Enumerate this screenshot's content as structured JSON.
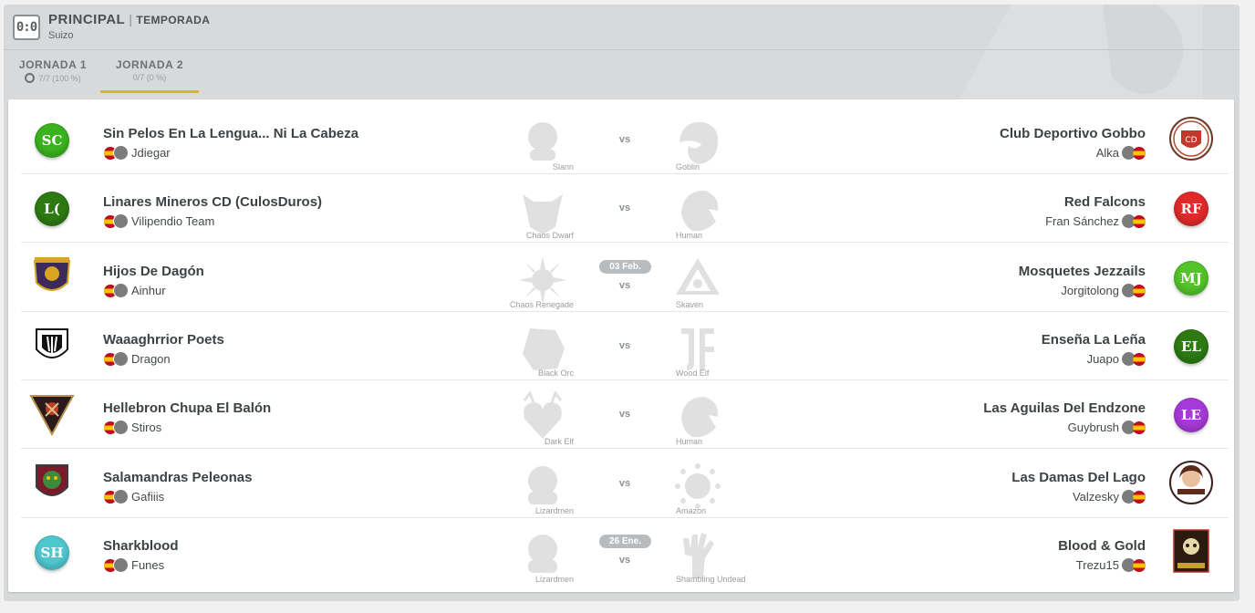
{
  "header": {
    "icon": "scoreboard-icon",
    "icon_text": "0:0",
    "title": "PRINCIPAL",
    "separator": "|",
    "subtitle": "TEMPORADA",
    "system": "Suizo"
  },
  "tabs": [
    {
      "label": "JORNADA 1",
      "stat": "7/7 (100 %)",
      "active": false
    },
    {
      "label": "JORNADA 2",
      "stat": "0/7 (0 %)",
      "active": true
    }
  ],
  "vs_label": "vs",
  "matches": [
    {
      "home": {
        "name": "Sin Pelos En La Lengua... Ni La Cabeza",
        "coach": "Jdiegar",
        "race": "Slann",
        "logo_text": "SC",
        "logo_color": "#3bb31e"
      },
      "away": {
        "name": "Club Deportivo Gobbo",
        "coach": "Alka",
        "race": "Goblin",
        "logo_icon": "club-deportivo-gobbo-crest-icon"
      },
      "date": ""
    },
    {
      "home": {
        "name": "Linares Mineros CD (CulosDuros)",
        "coach": "Vilipendio Team",
        "race": "Chaos Dwarf",
        "logo_text": "L(",
        "logo_color": "#2d7a12"
      },
      "away": {
        "name": "Red Falcons",
        "coach": "Fran Sánchez",
        "race": "Human",
        "logo_text": "RF",
        "logo_color": "#e02a2a"
      },
      "date": ""
    },
    {
      "home": {
        "name": "Hijos De Dagón",
        "coach": "Ainhur",
        "race": "Chaos Renegade",
        "logo_icon": "hijos-de-dagon-crest-icon"
      },
      "away": {
        "name": "Mosquetes Jezzails",
        "coach": "Jorgitolong",
        "race": "Skaven",
        "logo_text": "MJ",
        "logo_color": "#54c32a"
      },
      "date": "03 Feb."
    },
    {
      "home": {
        "name": "Waaaghrrior Poets",
        "coach": "Dragon",
        "race": "Black Orc",
        "logo_icon": "waaaghrrior-poets-crest-icon"
      },
      "away": {
        "name": "Enseña La Leña",
        "coach": "Juapo",
        "race": "Wood Elf",
        "logo_text": "EL",
        "logo_color": "#2d7a12"
      },
      "date": ""
    },
    {
      "home": {
        "name": "Hellebron Chupa El Balón",
        "coach": "Stiros",
        "race": "Dark Elf",
        "logo_icon": "hellebron-crest-icon"
      },
      "away": {
        "name": "Las Aguilas Del Endzone",
        "coach": "Guybrush",
        "race": "Human",
        "logo_text": "LE",
        "logo_color": "#a63ad9"
      },
      "date": ""
    },
    {
      "home": {
        "name": "Salamandras Peleonas",
        "coach": "Gafiiis",
        "race": "Lizardmen",
        "logo_icon": "salamandras-crest-icon"
      },
      "away": {
        "name": "Las Damas Del Lago",
        "coach": "Valzesky",
        "race": "Amazon",
        "logo_icon": "las-damas-del-lago-crest-icon"
      },
      "date": ""
    },
    {
      "home": {
        "name": "Sharkblood",
        "coach": "Funes",
        "race": "Lizardmen",
        "logo_text": "SH",
        "logo_color": "#4fc7cf"
      },
      "away": {
        "name": "Blood & Gold",
        "coach": "Trezu15",
        "race": "Shambling Undead",
        "logo_icon": "blood-and-gold-crest-icon"
      },
      "date": "26 Ene."
    }
  ]
}
